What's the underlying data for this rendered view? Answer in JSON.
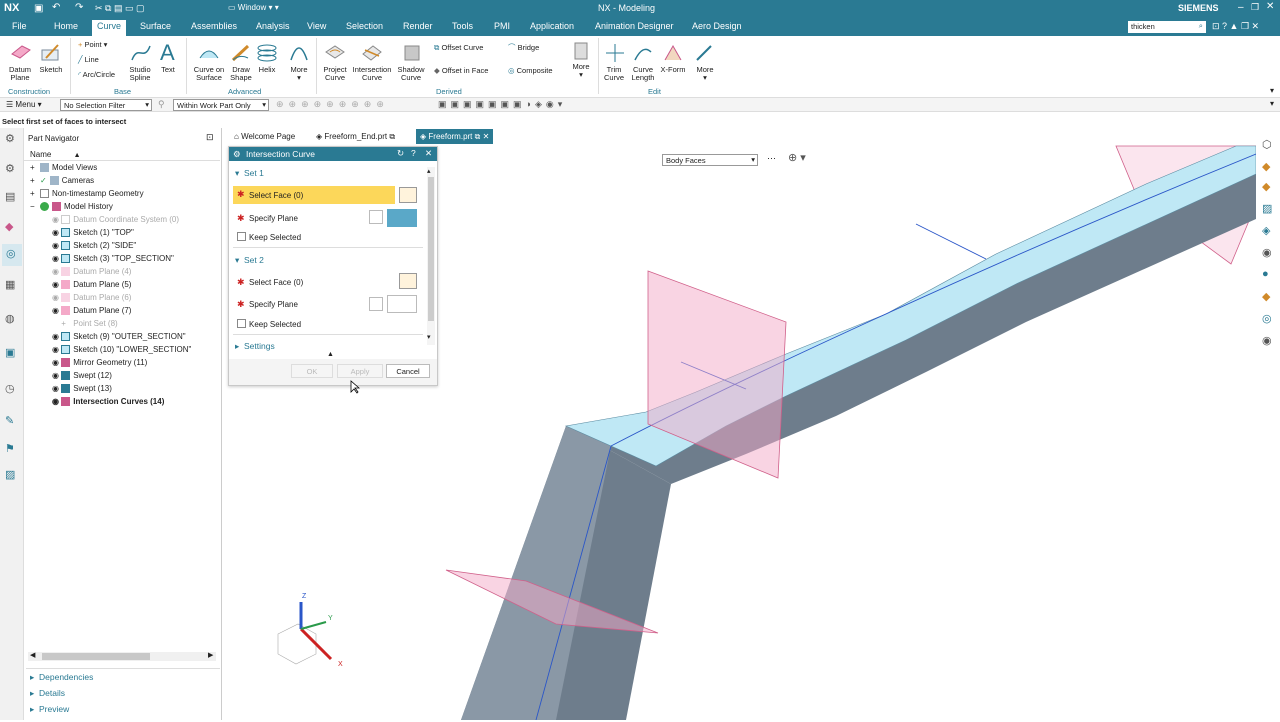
{
  "titlebar": {
    "app": "NX",
    "window_menu": "Window",
    "title": "NX - Modeling",
    "brand": "SIEMENS",
    "search_value": "thicken"
  },
  "menubar": [
    "File",
    "Home",
    "Curve",
    "Surface",
    "Assemblies",
    "Analysis",
    "View",
    "Selection",
    "Render",
    "Tools",
    "PMI",
    "Application",
    "Animation Designer",
    "Aero Design"
  ],
  "ribbon": {
    "construction": {
      "datum_plane": "Datum\nPlane",
      "sketch": "Sketch",
      "group": "Construction"
    },
    "base": {
      "point": "Point",
      "line": "Line",
      "arc": "Arc/Circle",
      "studio_spline": "Studio\nSpline",
      "text": "Text",
      "group": "Base"
    },
    "advanced": {
      "curve_on_surface": "Curve on\nSurface",
      "draw_shape": "Draw\nShape",
      "helix": "Helix",
      "more": "More",
      "group": "Advanced"
    },
    "derived": {
      "project_curve": "Project\nCurve",
      "intersection_curve": "Intersection\nCurve",
      "shadow_curve": "Shadow\nCurve",
      "offset_curve": "Offset Curve",
      "bridge": "Bridge",
      "offset_in_face": "Offset in Face",
      "composite": "Composite",
      "more": "More",
      "group": "Derived"
    },
    "edit": {
      "trim_curve": "Trim\nCurve",
      "curve_length": "Curve\nLength",
      "xform": "X-Form",
      "more": "More",
      "group": "Edit"
    }
  },
  "selbar": {
    "menu": "Menu",
    "filter": "No Selection Filter",
    "scope": "Within Work Part Only"
  },
  "cue": "Select first set of faces to intersect",
  "navigator": {
    "title": "Part Navigator",
    "column": "Name",
    "items": [
      {
        "label": "Model Views",
        "dim": false
      },
      {
        "label": "Cameras",
        "dim": false
      },
      {
        "label": "Non-timestamp Geometry",
        "dim": false
      },
      {
        "label": "Model History",
        "dim": false
      },
      {
        "label": "Datum Coordinate System (0)",
        "dim": true
      },
      {
        "label": "Sketch (1) \"TOP\"",
        "dim": false
      },
      {
        "label": "Sketch (2) \"SIDE\"",
        "dim": false
      },
      {
        "label": "Sketch (3) \"TOP_SECTION\"",
        "dim": false
      },
      {
        "label": "Datum Plane (4)",
        "dim": true
      },
      {
        "label": "Datum Plane (5)",
        "dim": false
      },
      {
        "label": "Datum Plane (6)",
        "dim": true
      },
      {
        "label": "Datum Plane (7)",
        "dim": false
      },
      {
        "label": "Point Set (8)",
        "dim": true
      },
      {
        "label": "Sketch (9) \"OUTER_SECTION\"",
        "dim": false
      },
      {
        "label": "Sketch (10) \"LOWER_SECTION\"",
        "dim": false
      },
      {
        "label": "Mirror Geometry (11)",
        "dim": false
      },
      {
        "label": "Swept (12)",
        "dim": false
      },
      {
        "label": "Swept (13)",
        "dim": false
      },
      {
        "label": "Intersection Curves (14)",
        "dim": false
      }
    ],
    "sections": [
      "Dependencies",
      "Details",
      "Preview"
    ]
  },
  "tabs": [
    {
      "label": "Welcome Page",
      "active": false
    },
    {
      "label": "Freeform_End.prt",
      "active": false
    },
    {
      "label": "Freeform.prt",
      "active": true
    }
  ],
  "dialog": {
    "title": "Intersection Curve",
    "set1": "Set 1",
    "select_face1": "Select Face (0)",
    "specify_plane1": "Specify Plane",
    "keep1": "Keep Selected",
    "set2": "Set 2",
    "select_face2": "Select Face (0)",
    "specify_plane2": "Specify Plane",
    "keep2": "Keep Selected",
    "settings": "Settings",
    "ok": "OK",
    "apply": "Apply",
    "cancel": "Cancel"
  },
  "viewport": {
    "type_filter": "Body Faces",
    "triad": {
      "z": "Z",
      "y": "Y",
      "x": "X"
    }
  },
  "colors": {
    "accent": "#2a7a93",
    "face_selected": "#bfe8f5",
    "body_side": "#6e7d8c",
    "plane": "#f4a9c8",
    "required": "#cc2222",
    "highlight": "#fcd75a"
  }
}
